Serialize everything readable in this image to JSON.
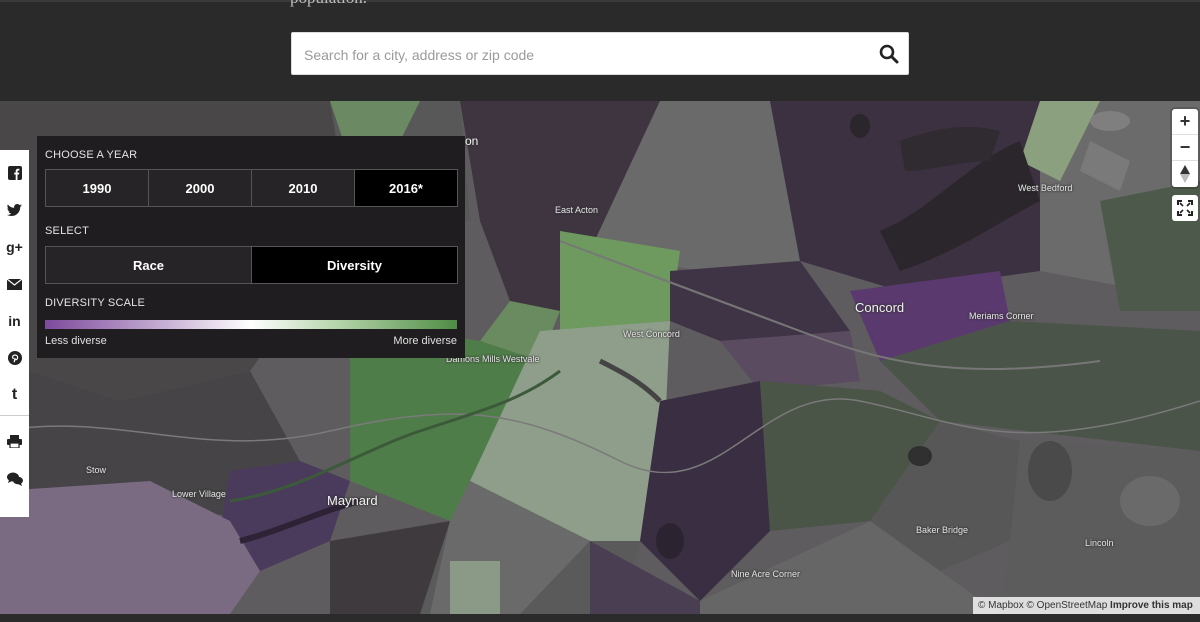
{
  "header": {
    "intro_text": "population.",
    "search": {
      "placeholder": "Search for a city, address or zip code",
      "value": ""
    }
  },
  "panel": {
    "year_label": "CHOOSE A YEAR",
    "years": [
      "1990",
      "2000",
      "2010",
      "2016*"
    ],
    "selected_year": "2016*",
    "select_label": "SELECT",
    "modes": [
      "Race",
      "Diversity"
    ],
    "selected_mode": "Diversity",
    "scale_label": "DIVERSITY SCALE",
    "scale_left": "Less diverse",
    "scale_right": "More diverse",
    "scale_colors": [
      "#7d4a9c",
      "#ffffff",
      "#4f8c45"
    ]
  },
  "places": {
    "concord": "Concord",
    "maynard": "Maynard",
    "east_acton": "East Acton",
    "west_concord": "West Concord",
    "damons_mills": "Damons Mills Westvale",
    "west_bedford": "West Bedford",
    "meriams_corner": "Meriams Corner",
    "stow": "Stow",
    "lower_village": "Lower Village",
    "baker_bridge": "Baker Bridge",
    "lincoln": "Lincoln",
    "nine_acre_corner": "Nine Acre Corner",
    "acton_partial": "on"
  },
  "map_controls": {
    "zoom_in": "+",
    "zoom_out": "−"
  },
  "share_icons": [
    "facebook-icon",
    "twitter-icon",
    "google-plus-icon",
    "email-icon",
    "linkedin-icon",
    "pinterest-icon",
    "tumblr-icon",
    "print-icon",
    "comments-icon"
  ],
  "share_glyphs": {
    "facebook": "f",
    "twitter": "t",
    "googleplus": "g+",
    "linkedin": "in",
    "pinterest": "p",
    "tumblr": "t"
  },
  "attribution": {
    "mapbox": "© Mapbox",
    "osm": "© OpenStreetMap",
    "improve": "Improve this map"
  }
}
